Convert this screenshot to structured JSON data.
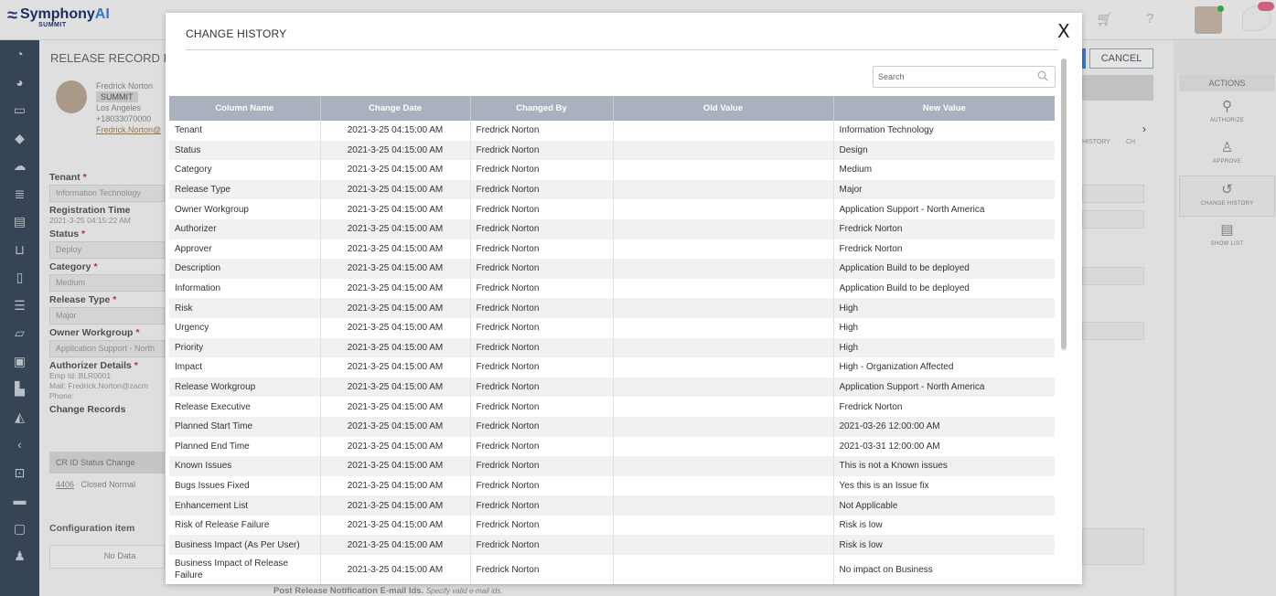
{
  "app": {
    "logo_text": "Symphony",
    "logo_text_ai": "AI",
    "logo_sub": "SUMMIT"
  },
  "background": {
    "page_title": "RELEASE RECORD ID -",
    "cancel_label": "CANCEL",
    "profile": {
      "name": "Fredrick Norton",
      "tag": "SUMMIT",
      "city": "Los Angeles",
      "phone": "+18033070000",
      "email": "Fredrick.Norton@"
    },
    "fields": [
      {
        "label": "Tenant",
        "value": "Information Technology"
      },
      {
        "label": "Registration Time",
        "value": "2021-3-25 04:15:22 AM"
      },
      {
        "label": "Status",
        "value": "Deploy"
      },
      {
        "label": "Category",
        "value": "Medium"
      },
      {
        "label": "Release Type",
        "value": "Major"
      },
      {
        "label": "Owner Workgroup",
        "value": "Application Support - North"
      }
    ],
    "authorizer_label": "Authorizer Details",
    "emp_id": "Emp Id: BLR0001",
    "mail": "Mail: Fredrick.Norton@zacm",
    "phone": "Phone:",
    "change_records_label": "Change Records",
    "cr_headers": "CR ID   Status   Change",
    "cr_row_id": "4406",
    "cr_row_rest": "Closed   Normal",
    "config_label": "Configuration item",
    "no_data": "No Data",
    "post_release": "Post Release Notification E-mail Ids.",
    "post_release_hint": "Specify valid e-mail ids.",
    "history_tab": "HISTORY",
    "ch_tab": "CH"
  },
  "actions": {
    "title": "ACTIONS",
    "items": [
      {
        "label": "AUTHORIZE",
        "icon": "key-icon"
      },
      {
        "label": "APPROVE",
        "icon": "user-check-icon"
      },
      {
        "label": "CHANGE HISTORY",
        "icon": "history-icon"
      },
      {
        "label": "SHOW LIST",
        "icon": "document-icon"
      }
    ]
  },
  "modal": {
    "title": "CHANGE HISTORY",
    "close_label": "X",
    "search_placeholder": "Search",
    "columns": [
      "Column Name",
      "Change Date",
      "Changed By",
      "Old Value",
      "New Value"
    ],
    "rows": [
      {
        "column": "Tenant",
        "date": "2021-3-25 04:15:00 AM",
        "by": "Fredrick Norton",
        "old": "",
        "new": "Information Technology"
      },
      {
        "column": "Status",
        "date": "2021-3-25 04:15:00 AM",
        "by": "Fredrick Norton",
        "old": "",
        "new": "Design"
      },
      {
        "column": "Category",
        "date": "2021-3-25 04:15:00 AM",
        "by": "Fredrick Norton",
        "old": "",
        "new": "Medium"
      },
      {
        "column": "Release Type",
        "date": "2021-3-25 04:15:00 AM",
        "by": "Fredrick Norton",
        "old": "",
        "new": "Major"
      },
      {
        "column": "Owner Workgroup",
        "date": "2021-3-25 04:15:00 AM",
        "by": "Fredrick Norton",
        "old": "",
        "new": "Application Support - North America"
      },
      {
        "column": "Authorizer",
        "date": "2021-3-25 04:15:00 AM",
        "by": "Fredrick Norton",
        "old": "",
        "new": "Fredrick Norton"
      },
      {
        "column": "Approver",
        "date": "2021-3-25 04:15:00 AM",
        "by": "Fredrick Norton",
        "old": "",
        "new": "Fredrick Norton"
      },
      {
        "column": "Description",
        "date": "2021-3-25 04:15:00 AM",
        "by": "Fredrick Norton",
        "old": "",
        "new": "Application Build to be deployed"
      },
      {
        "column": "Information",
        "date": "2021-3-25 04:15:00 AM",
        "by": "Fredrick Norton",
        "old": "",
        "new": "Application Build to be deployed"
      },
      {
        "column": "Risk",
        "date": "2021-3-25 04:15:00 AM",
        "by": "Fredrick Norton",
        "old": "",
        "new": "High"
      },
      {
        "column": "Urgency",
        "date": "2021-3-25 04:15:00 AM",
        "by": "Fredrick Norton",
        "old": "",
        "new": "High"
      },
      {
        "column": "Priority",
        "date": "2021-3-25 04:15:00 AM",
        "by": "Fredrick Norton",
        "old": "",
        "new": "High"
      },
      {
        "column": "Impact",
        "date": "2021-3-25 04:15:00 AM",
        "by": "Fredrick Norton",
        "old": "",
        "new": "High - Organization Affected"
      },
      {
        "column": "Release Workgroup",
        "date": "2021-3-25 04:15:00 AM",
        "by": "Fredrick Norton",
        "old": "",
        "new": "Application Support - North America"
      },
      {
        "column": "Release Executive",
        "date": "2021-3-25 04:15:00 AM",
        "by": "Fredrick Norton",
        "old": "",
        "new": "Fredrick Norton"
      },
      {
        "column": "Planned Start Time",
        "date": "2021-3-25 04:15:00 AM",
        "by": "Fredrick Norton",
        "old": "",
        "new": "2021-03-26 12:00:00 AM"
      },
      {
        "column": "Planned End Time",
        "date": "2021-3-25 04:15:00 AM",
        "by": "Fredrick Norton",
        "old": "",
        "new": "2021-03-31 12:00:00 AM"
      },
      {
        "column": "Known Issues",
        "date": "2021-3-25 04:15:00 AM",
        "by": "Fredrick Norton",
        "old": "",
        "new": "This is not a Known issues"
      },
      {
        "column": "Bugs Issues Fixed",
        "date": "2021-3-25 04:15:00 AM",
        "by": "Fredrick Norton",
        "old": "",
        "new": "Yes this is an Issue fix"
      },
      {
        "column": "Enhancement List",
        "date": "2021-3-25 04:15:00 AM",
        "by": "Fredrick Norton",
        "old": "",
        "new": "Not Applicable"
      },
      {
        "column": "Risk of Release Failure",
        "date": "2021-3-25 04:15:00 AM",
        "by": "Fredrick Norton",
        "old": "",
        "new": "Risk is low"
      },
      {
        "column": "Business Impact (As Per User)",
        "date": "2021-3-25 04:15:00 AM",
        "by": "Fredrick Norton",
        "old": "",
        "new": "Risk is low"
      },
      {
        "column": "Business Impact of Release Failure",
        "date": "2021-3-25 04:15:00 AM",
        "by": "Fredrick Norton",
        "old": "",
        "new": "No impact on Business"
      }
    ]
  }
}
